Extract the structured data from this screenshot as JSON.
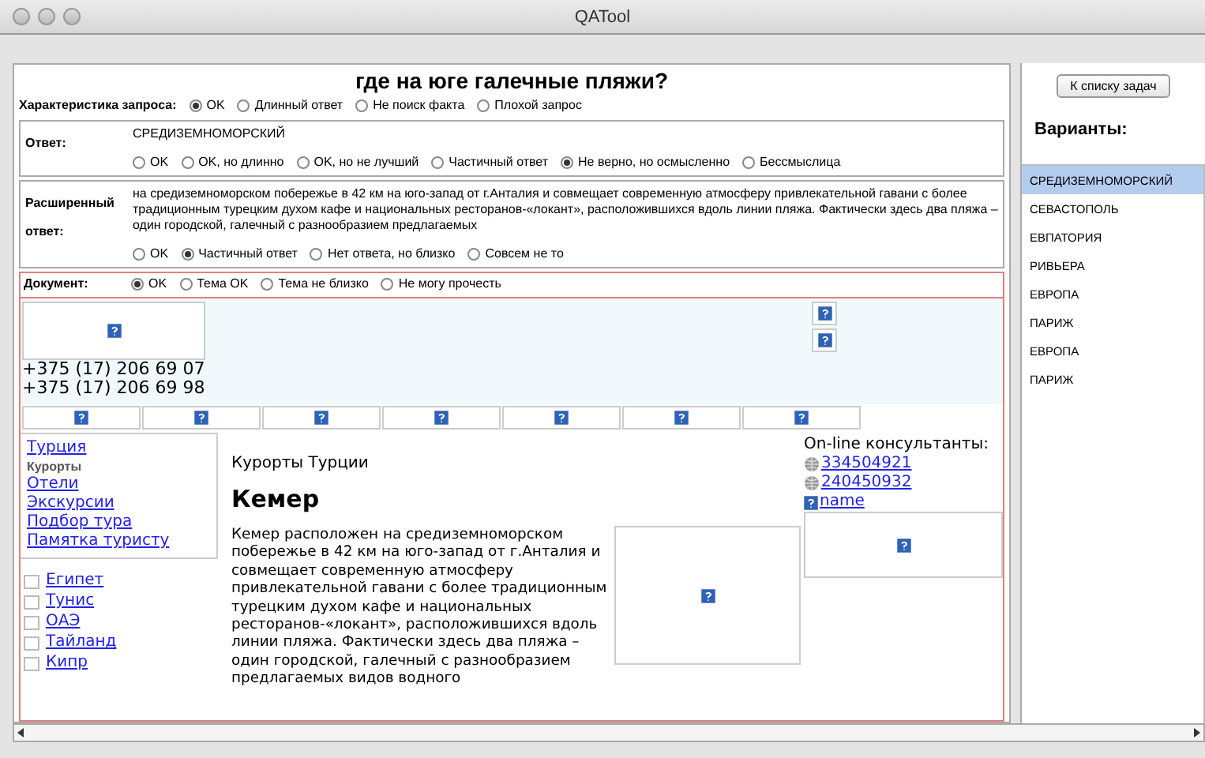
{
  "window": {
    "title": "QATool"
  },
  "question": "где на юге галечные пляжи?",
  "query_rating": {
    "label": "Характеристика запроса:",
    "options": [
      {
        "label": "OK",
        "selected": true
      },
      {
        "label": "Длинный ответ",
        "selected": false
      },
      {
        "label": "Не поиск факта",
        "selected": false
      },
      {
        "label": "Плохой запрос",
        "selected": false
      }
    ]
  },
  "answer": {
    "label": "Ответ:",
    "value": "СРЕДИЗЕМНОМОРСКИЙ",
    "options": [
      {
        "label": "OK",
        "selected": false
      },
      {
        "label": "OK, но длинно",
        "selected": false
      },
      {
        "label": "OK, но не лучший",
        "selected": false
      },
      {
        "label": "Частичный ответ",
        "selected": false
      },
      {
        "label": "Не верно, но осмысленно",
        "selected": true
      },
      {
        "label": "Бессмыслица",
        "selected": false
      }
    ]
  },
  "extended_answer": {
    "label": "Расширенный ответ:",
    "text": "на средиземноморском побережье в 42 км на юго-запад от г.Анталия и совмещает современную атмосферу привлекательной гавани с более традиционным турецким духом кафе и национальных ресторанов-«локант», расположившихся вдоль линии пляжа. Фактически здесь два пляжа – один городской, галечный с разнообразием предлагаемых",
    "options": [
      {
        "label": "OK",
        "selected": false
      },
      {
        "label": "Частичный ответ",
        "selected": true
      },
      {
        "label": "Нет ответа, но близко",
        "selected": false
      },
      {
        "label": "Совсем не то",
        "selected": false
      }
    ]
  },
  "document": {
    "label": "Документ:",
    "options": [
      {
        "label": "OK",
        "selected": true
      },
      {
        "label": "Тема OK",
        "selected": false
      },
      {
        "label": "Тема не близко",
        "selected": false
      },
      {
        "label": "Не могу прочесть",
        "selected": false
      }
    ],
    "page": {
      "phones": [
        "+375 (17) 206 69 07",
        "+375 (17) 206 69 98"
      ],
      "nav_top": {
        "link": "Турция",
        "heading": "Курорты",
        "links": [
          "Отели",
          "Экскурсии",
          "Подбор тура",
          "Памятка туристу"
        ]
      },
      "countries": [
        "Египет",
        "Тунис",
        "ОАЭ",
        "Тайланд",
        "Кипр"
      ],
      "breadcrumb": "Курорты Турции",
      "heading": "Кемер",
      "paragraph": "Кемер расположен на средиземноморском побережье в 42 км на юго-запад от г.Анталия и совмещает современную атмосферу привлекательной гавани с более традиционным турецким духом кафе и национальных ресторанов-«локант», расположившихся вдоль линии пляжа. Фактически здесь два пляжа – один городской, галечный с разнообразием предлагаемых видов водного",
      "consultants": {
        "title": "On-line консультанты:",
        "links": [
          {
            "kind": "globe",
            "label": "334504921"
          },
          {
            "kind": "globe",
            "label": "240450932"
          },
          {
            "kind": "image",
            "label": "name"
          }
        ]
      }
    }
  },
  "task_list_button": "К списку задач",
  "variants": {
    "title": "Варианты:",
    "items": [
      {
        "label": "СРЕДИЗЕМНОМОРСКИЙ",
        "selected": true
      },
      {
        "label": "СЕВАСТОПОЛЬ",
        "selected": false
      },
      {
        "label": "ЕВПАТОРИЯ",
        "selected": false
      },
      {
        "label": "РИВЬЕРА",
        "selected": false
      },
      {
        "label": "ЕВРОПА",
        "selected": false
      },
      {
        "label": "ПАРИЖ",
        "selected": false
      },
      {
        "label": "ЕВРОПА",
        "selected": false
      },
      {
        "label": "ПАРИЖ",
        "selected": false
      }
    ]
  }
}
